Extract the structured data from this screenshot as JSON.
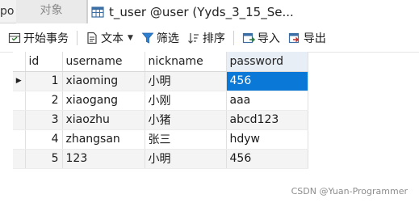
{
  "tabs": {
    "edge_text": "po",
    "objects_label": "对象",
    "active_label": "t_user @user (Yyds_3_15_Se..."
  },
  "toolbar": {
    "begin_transaction": "开始事务",
    "text": "文本",
    "filter": "筛选",
    "sort": "排序",
    "import": "导入",
    "export": "导出"
  },
  "grid": {
    "columns": [
      "id",
      "username",
      "nickname",
      "password"
    ],
    "rows": [
      [
        "1",
        "xiaoming",
        "小明",
        "456"
      ],
      [
        "2",
        "xiaogang",
        "小刚",
        "aaa"
      ],
      [
        "3",
        "xiaozhu",
        "小猪",
        "abcd123"
      ],
      [
        "4",
        "zhangsan",
        "张三",
        "hdyw"
      ],
      [
        "5",
        "123",
        "小明",
        "456"
      ]
    ],
    "current_row_marker": "▶"
  },
  "watermark": "CSDN @Yuan-Programmer",
  "colors": {
    "selection": "#0a78d6",
    "filter_icon": "#2f7fd1"
  }
}
